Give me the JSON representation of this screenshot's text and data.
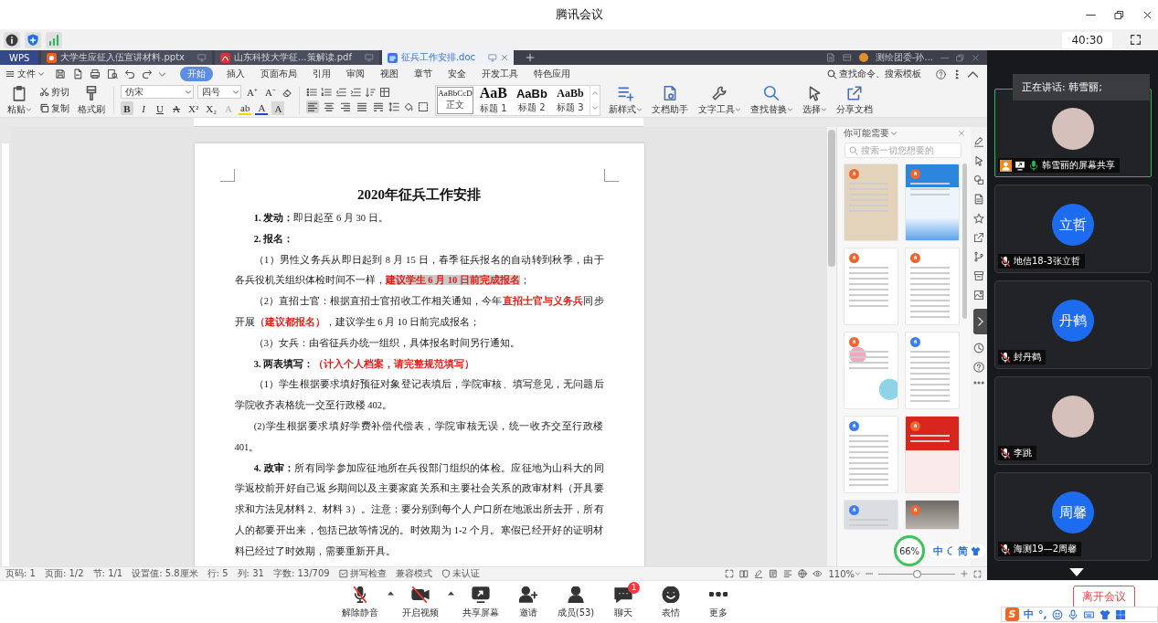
{
  "window": {
    "title": "腾讯会议"
  },
  "info_bar": {
    "timer": "40:30"
  },
  "wps": {
    "tabs": [
      {
        "label": "WPS",
        "kind": "home",
        "selected": false
      },
      {
        "label": "大学生应征入伍宣讲材料.pptx",
        "kind": "pptx",
        "selected": false
      },
      {
        "label": "山东科技大学征...策解读.pdf",
        "kind": "pdf",
        "selected": false
      },
      {
        "label": "征兵工作安排.doc",
        "kind": "doc",
        "selected": true
      }
    ],
    "account": "测绘团委-孙...",
    "file_menu": "文件",
    "ribbon_tabs": [
      {
        "label": "开始",
        "selected": true
      },
      {
        "label": "插入",
        "selected": false
      },
      {
        "label": "页面布局",
        "selected": false
      },
      {
        "label": "引用",
        "selected": false
      },
      {
        "label": "审阅",
        "selected": false
      },
      {
        "label": "视图",
        "selected": false
      },
      {
        "label": "章节",
        "selected": false
      },
      {
        "label": "安全",
        "selected": false
      },
      {
        "label": "开发工具",
        "selected": false
      },
      {
        "label": "特色应用",
        "selected": false
      }
    ],
    "command_search": "查找命令、搜索模板",
    "clipboard": {
      "paste": "粘贴",
      "cut": "剪切",
      "copy": "复制",
      "format_painter": "格式刷"
    },
    "font": {
      "name": "仿宋",
      "size": "四号",
      "size_buttons": [
        "A⁺",
        "A⁻"
      ],
      "style_buttons": [
        {
          "label": "B",
          "kind": "bold",
          "selected": true
        },
        {
          "label": "I",
          "kind": "italic",
          "selected": false
        },
        {
          "label": "U",
          "kind": "underline",
          "selected": false
        },
        {
          "label": "A",
          "kind": "strike",
          "selected": false
        },
        {
          "label": "X²",
          "kind": "sup",
          "selected": false
        },
        {
          "label": "X₂",
          "kind": "sub",
          "selected": false
        },
        {
          "label": "A",
          "kind": "outline",
          "selected": false
        },
        {
          "label": "ab",
          "kind": "highlight",
          "selected": false
        },
        {
          "label": "A",
          "kind": "color",
          "selected": false
        },
        {
          "label": "A",
          "kind": "shade",
          "selected": false
        }
      ]
    },
    "align_buttons": [
      {
        "kind": "left",
        "selected": true
      },
      {
        "kind": "center",
        "selected": false
      },
      {
        "kind": "right",
        "selected": false
      },
      {
        "kind": "justify",
        "selected": false
      },
      {
        "kind": "distribute",
        "selected": false
      }
    ],
    "styles": [
      {
        "sample": "AaBbCcD",
        "label": "正文",
        "kind": "body",
        "selected": true
      },
      {
        "sample": "AaB",
        "label": "标题 1",
        "kind": "heading1",
        "selected": false
      },
      {
        "sample": "AaBb",
        "label": "标题 2",
        "kind": "heading2",
        "selected": false
      },
      {
        "sample": "AaBb",
        "label": "标题 3",
        "kind": "heading3",
        "selected": false
      }
    ],
    "tools": [
      {
        "label": "新样式",
        "kind": "new-style",
        "dropdown": true
      },
      {
        "label": "文档助手",
        "kind": "assistant",
        "dropdown": false
      },
      {
        "label": "文字工具",
        "kind": "text-tools",
        "dropdown": true
      },
      {
        "label": "查找替换",
        "kind": "find",
        "dropdown": true
      },
      {
        "label": "选择",
        "kind": "select",
        "dropdown": true
      },
      {
        "label": "分享文档",
        "kind": "share",
        "dropdown": false
      }
    ],
    "document": {
      "title": "2020年征兵工作安排",
      "paragraphs": [
        {
          "runs": [
            {
              "text": "1. 发动：",
              "kind": "bold"
            },
            {
              "text": "即日起至 6 月 30 日。",
              "kind": "plain"
            }
          ]
        },
        {
          "runs": [
            {
              "text": "2. 报名：",
              "kind": "bold"
            }
          ]
        },
        {
          "runs": [
            {
              "text": "（1）男性义务兵从即日起到 8 月 15 日，春季征兵报名的自动转到秋季，由于各兵役机关组织体检时间不一样，",
              "kind": "plain"
            },
            {
              "text": "建议学生 6 月 10 日前完成报名",
              "kind": "marked"
            },
            {
              "text": "；",
              "kind": "plain"
            }
          ]
        },
        {
          "runs": [
            {
              "text": "（2）直招士官：根据直招士官招收工作相关通知，今年",
              "kind": "plain"
            },
            {
              "text": "直招士官与义务兵",
              "kind": "red"
            },
            {
              "text": "同步开展",
              "kind": "plain"
            },
            {
              "text": "（建议都报名）",
              "kind": "red"
            },
            {
              "text": "，建议学生 6 月 10 日前完成报名；",
              "kind": "plain"
            }
          ]
        },
        {
          "runs": [
            {
              "text": "（3）女兵：由省征兵办统一组织，具体报名时间另行通知。",
              "kind": "plain"
            }
          ]
        },
        {
          "runs": [
            {
              "text": "3. 两表填写：",
              "kind": "bold"
            },
            {
              "text": "（计入个人档案，请完整规范填写）",
              "kind": "red"
            }
          ]
        },
        {
          "runs": [
            {
              "text": "（1）学生根据要求填好预征对象登记表填后，学院审核、填写意见，无问题后学院收齐表格统一交至行政楼 402。",
              "kind": "plain"
            }
          ]
        },
        {
          "runs": [
            {
              "text": "(2)学生根据要求填好学费补偿代偿表，学院审核无误，统一收齐交至行政楼 401。",
              "kind": "plain"
            }
          ]
        },
        {
          "runs": [
            {
              "text": "4. 政审：",
              "kind": "bold"
            },
            {
              "text": "所有同学参加应征地所在兵役部门组织的体检。应征地为山科大的同学返校前开好自己返乡期间以及主要家庭关系和主要社会关系的政审材料（开具要求和方法见材料 2、材料 3）。注意：要分别到每个人户口所在地派出所去开，所有人的都要开出来，包括已故等情况的。时效期为 1-2 个月。寒假已经开好的证明材料已经过了时效期，需要重新开具。",
              "kind": "plain"
            }
          ]
        }
      ]
    },
    "task_pane": {
      "title": "你可能需要",
      "search_placeholder": "搜索一切您想要的",
      "templates": [
        {
          "kind": "paper",
          "color": "#f0642d"
        },
        {
          "kind": "screenshot",
          "color": "#f0642d"
        },
        {
          "kind": "form",
          "color": "#f0642d"
        },
        {
          "kind": "text",
          "color": "#f0642d"
        },
        {
          "kind": "poster",
          "color": "#f0642d"
        },
        {
          "kind": "text",
          "color": "#3a7ef0"
        },
        {
          "kind": "text",
          "color": "#3a7ef0"
        },
        {
          "kind": "report",
          "color": "#f0642d"
        },
        {
          "kind": "plan",
          "color": "#3a7ef0"
        },
        {
          "kind": "photo",
          "color": "#f0642d"
        }
      ]
    },
    "status_bar": {
      "items": [
        {
          "text": "页码: 1",
          "kind": "text"
        },
        {
          "text": "页面: 1/2",
          "kind": "text"
        },
        {
          "text": "节: 1/1",
          "kind": "text"
        },
        {
          "text": "设置值: 5.8厘米",
          "kind": "text"
        },
        {
          "text": "行: 5",
          "kind": "text"
        },
        {
          "text": "列: 31",
          "kind": "text"
        },
        {
          "text": "字数: 13/709",
          "kind": "text"
        },
        {
          "text": "拼写检查",
          "kind": "spell"
        },
        {
          "text": "兼容模式",
          "kind": "text"
        },
        {
          "text": "未认证",
          "kind": "certificate"
        }
      ],
      "zoom": "110%",
      "zoom_slider": {
        "level": 0.5
      }
    },
    "floating_ime": {
      "percent": "66%",
      "mode": "中",
      "script": "简"
    }
  },
  "participants": {
    "speaking": "正在讲话: 韩雪丽;",
    "tiles": [
      {
        "name": "韩雪丽的屏幕共享",
        "kind": "picture",
        "speaking": true,
        "host": true,
        "sharing": true,
        "muted": false
      },
      {
        "name": "地信18-3张立哲",
        "kind": "initials",
        "avatar_text": "立哲",
        "speaking": false,
        "host": false,
        "sharing": false,
        "muted": true
      },
      {
        "name": "封丹鹤",
        "kind": "initials",
        "avatar_text": "丹鹤",
        "speaking": false,
        "host": false,
        "sharing": false,
        "muted": true
      },
      {
        "name": "李跳",
        "kind": "picture",
        "speaking": false,
        "host": false,
        "sharing": false,
        "muted": true
      },
      {
        "name": "海测19—2周馨",
        "kind": "initials",
        "avatar_text": "周馨",
        "speaking": false,
        "host": false,
        "sharing": false,
        "muted": true
      }
    ]
  },
  "toolbar": {
    "buttons": [
      {
        "label": "解除静音",
        "kind": "mic-off",
        "caret": true
      },
      {
        "label": "开启视频",
        "kind": "camera-off",
        "caret": true
      },
      {
        "label": "共享屏幕",
        "kind": "share-screen",
        "caret": false
      },
      {
        "label": "邀请",
        "kind": "invite",
        "caret": false
      },
      {
        "label": "成员(53)",
        "kind": "members",
        "caret": false
      },
      {
        "label": "聊天",
        "kind": "chat",
        "caret": false,
        "badge": "1"
      },
      {
        "label": "表情",
        "kind": "emoji",
        "caret": false
      },
      {
        "label": "更多",
        "kind": "more",
        "caret": false
      }
    ],
    "leave": "离开会议"
  },
  "ime_toolbar": {
    "logo": "S",
    "mode": "中",
    "punctuation": "°,"
  }
}
